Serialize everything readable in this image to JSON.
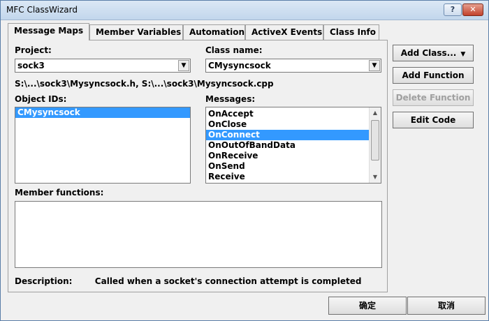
{
  "window": {
    "title": "MFC ClassWizard",
    "help_glyph": "?",
    "close_glyph": "✕"
  },
  "tabs": [
    {
      "label": "Message Maps",
      "active": true
    },
    {
      "label": "Member Variables"
    },
    {
      "label": "Automation"
    },
    {
      "label": "ActiveX Events"
    },
    {
      "label": "Class Info"
    }
  ],
  "project": {
    "label": "Project:",
    "value": "sock3"
  },
  "class_name": {
    "label": "Class name:",
    "value": "CMysyncsock"
  },
  "file_path": "S:\\...\\sock3\\Mysyncsock.h, S:\\...\\sock3\\Mysyncsock.cpp",
  "object_ids": {
    "label": "Object IDs:",
    "items": [
      "CMysyncsock"
    ],
    "selected": "CMysyncsock"
  },
  "messages": {
    "label": "Messages:",
    "items": [
      "OnAccept",
      "OnClose",
      "OnConnect",
      "OnOutOfBandData",
      "OnReceive",
      "OnSend",
      "Receive"
    ],
    "selected": "OnConnect"
  },
  "member_functions": {
    "label": "Member functions:"
  },
  "description": {
    "label": "Description:",
    "text": "Called when a socket's connection attempt is completed"
  },
  "buttons": {
    "add_class": "Add Class...",
    "add_function": "Add Function",
    "delete_function": "Delete Function",
    "edit_code": "Edit Code",
    "ok": "确定",
    "cancel": "取消"
  },
  "icons": {
    "dropdown": "▼",
    "scroll_up": "▲",
    "scroll_down": "▼"
  }
}
